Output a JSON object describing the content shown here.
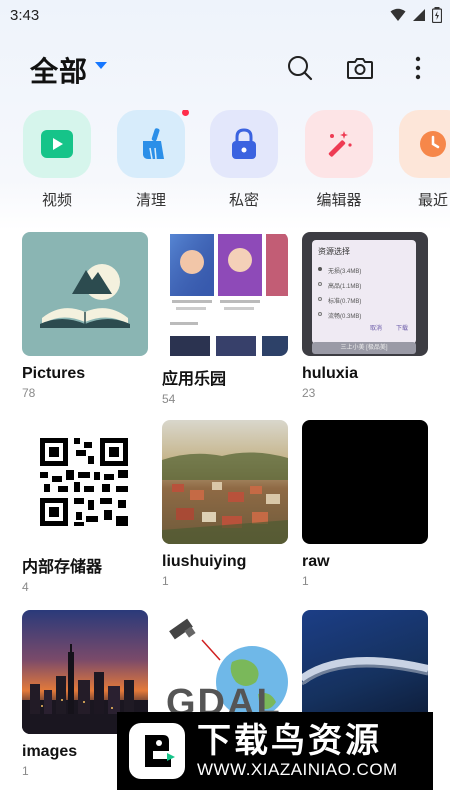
{
  "status_bar": {
    "time": "3:43"
  },
  "header": {
    "title": "全部"
  },
  "quick_actions": [
    {
      "label": "视频",
      "icon": "play-icon",
      "bg": "#d6f5ec"
    },
    {
      "label": "清理",
      "icon": "broom-icon",
      "bg": "#d7ecfb",
      "badge": true
    },
    {
      "label": "私密",
      "icon": "lock-icon",
      "bg": "#e3e7fb"
    },
    {
      "label": "编辑器",
      "icon": "magic-wand-icon",
      "bg": "#fde4e6"
    },
    {
      "label": "最近",
      "icon": "clock-icon",
      "bg": "#fde6d9"
    }
  ],
  "albums": [
    {
      "name": "Pictures",
      "count": "78"
    },
    {
      "name": "应用乐园",
      "count": "54"
    },
    {
      "name": "huluxia",
      "count": "23"
    },
    {
      "name": "内部存储器",
      "count": "4"
    },
    {
      "name": "liushuiying",
      "count": "1"
    },
    {
      "name": "raw",
      "count": "1"
    },
    {
      "name": "images",
      "count": "1"
    },
    {
      "name": "",
      "count": ""
    },
    {
      "name": "",
      "count": ""
    }
  ],
  "thumb_text": {
    "dialog_title": "资源选择",
    "options": [
      "无损(3.4MB)",
      "高品(1.1MB)",
      "标准(0.7MB)",
      "流畅(0.3MB)"
    ],
    "btn_cancel": "取消",
    "btn_download": "下载",
    "footer": "三上小美 [极品美]",
    "gdal": "GDAL"
  },
  "watermark": {
    "title": "下载鸟资源",
    "url": "WWW.XIAZAINIAO.COM"
  },
  "colors": {
    "accent": "#1677ff",
    "brand_green": "#16c489",
    "badge": "#ff2d4b"
  }
}
